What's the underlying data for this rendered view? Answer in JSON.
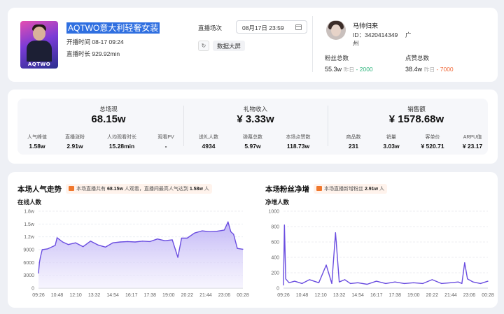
{
  "room": {
    "cover_tag": "AQTWO",
    "title": "AQTWO意大利轻奢女装",
    "start_time": "开播时间 08-17 09:24",
    "duration": "直播时长 929.92min",
    "session_label": "直播场次",
    "session_value": "08月17日 23:59",
    "big_screen_label": "数据大屏"
  },
  "streamer": {
    "name": "马帅归来",
    "id_line": "ID：3420414349",
    "location_a": "广",
    "location_b": "州",
    "fans_label": "粉丝总数",
    "fans_value": "55.3w",
    "fans_yday": "昨日",
    "fans_delta": "- 2000",
    "likes_label": "点赞总数",
    "likes_value": "38.4w",
    "likes_yday": "昨日",
    "likes_delta": "- 7000"
  },
  "metrics": [
    {
      "label": "总场观",
      "value": "68.15w",
      "subs": [
        {
          "label": "人气峰值",
          "value": "1.58w"
        },
        {
          "label": "直播涨粉",
          "value": "2.91w"
        },
        {
          "label": "人均观看时长",
          "value": "15.28min"
        },
        {
          "label": "观看PV",
          "value": "-"
        }
      ]
    },
    {
      "label": "礼物收入",
      "value": "¥ 3.33w",
      "subs": [
        {
          "label": "送礼人数",
          "value": "4934"
        },
        {
          "label": "弹幕总数",
          "value": "5.97w"
        },
        {
          "label": "本场点赞数",
          "value": "118.73w"
        }
      ]
    },
    {
      "label": "销售额",
      "value": "¥ 1578.68w",
      "subs": [
        {
          "label": "商品数",
          "value": "231"
        },
        {
          "label": "销量",
          "value": "3.03w"
        },
        {
          "label": "客单价",
          "value": "¥ 520.71"
        },
        {
          "label": "ARPU值",
          "value": "¥ 23.17"
        }
      ]
    }
  ],
  "chart_left_header": {
    "title": "本场人气走势",
    "note_pre": "本场直播共有",
    "note_v1": "68.15w",
    "note_mid": "人观看，直播间最高人气达到",
    "note_v2": "1.58w",
    "note_post": "人",
    "sub": "在线人数"
  },
  "chart_right_header": {
    "title": "本场粉丝净增",
    "note_pre": "本场直播新增粉丝",
    "note_v1": "2.91w",
    "note_post": "人",
    "sub": "净增人数"
  },
  "colors": {
    "line": "#6a4de0",
    "area_top": "#b9acf5",
    "area_bottom": "#f1eefd",
    "up": "#2fb57d",
    "down": "#f06a3a"
  },
  "chart_data": [
    {
      "type": "area",
      "title": "本场人气走势",
      "ylabel": "在线人数",
      "yticks": [
        "0",
        "3000",
        "6000",
        "9000",
        "1.2w",
        "1.5w",
        "1.8w"
      ],
      "ylim": [
        0,
        18000
      ],
      "xticks": [
        "09:26",
        "10:48",
        "12:10",
        "13:32",
        "14:54",
        "16:17",
        "17:38",
        "19:00",
        "20:22",
        "21:44",
        "23:06",
        "00:28"
      ],
      "x": [
        0,
        0.05,
        0.1,
        0.2,
        0.5,
        0.9,
        1.0,
        1.3,
        1.6,
        2.0,
        2.4,
        2.8,
        3.2,
        3.6,
        4.0,
        4.4,
        4.8,
        5.2,
        5.6,
        6.0,
        6.4,
        6.8,
        7.2,
        7.5,
        7.7,
        8.0,
        8.4,
        8.8,
        9.2,
        9.6,
        10.0,
        10.2,
        10.35,
        10.5,
        10.7,
        11.0
      ],
      "y": [
        3500,
        6000,
        7200,
        9000,
        9200,
        10000,
        11800,
        10800,
        10200,
        10600,
        9700,
        11000,
        10100,
        9600,
        10600,
        10800,
        10900,
        10800,
        11000,
        10900,
        11500,
        11100,
        11300,
        7200,
        11700,
        11700,
        12900,
        13400,
        13200,
        13300,
        13600,
        15500,
        13200,
        12600,
        9300,
        9100
      ]
    },
    {
      "type": "line",
      "title": "本场粉丝净增",
      "ylabel": "净增人数",
      "yticks": [
        "0",
        "200",
        "400",
        "600",
        "800",
        "1000"
      ],
      "ylim": [
        0,
        1000
      ],
      "xticks": [
        "09:26",
        "10:48",
        "12:10",
        "13:32",
        "14:54",
        "16:17",
        "17:38",
        "19:00",
        "20:22",
        "21:44",
        "23:06",
        "00:28"
      ],
      "x": [
        0,
        0.05,
        0.12,
        0.3,
        0.6,
        1.0,
        1.4,
        1.9,
        2.3,
        2.6,
        2.8,
        3.0,
        3.3,
        3.6,
        4.0,
        4.5,
        5.0,
        5.5,
        6.0,
        6.5,
        7.0,
        7.5,
        8.0,
        8.5,
        9.0,
        9.4,
        9.6,
        9.75,
        9.9,
        10.2,
        10.6,
        11.0
      ],
      "y": [
        40,
        820,
        120,
        70,
        90,
        60,
        110,
        70,
        300,
        60,
        720,
        80,
        110,
        60,
        70,
        50,
        90,
        60,
        80,
        60,
        70,
        60,
        110,
        60,
        70,
        80,
        60,
        330,
        120,
        80,
        60,
        90
      ]
    }
  ]
}
